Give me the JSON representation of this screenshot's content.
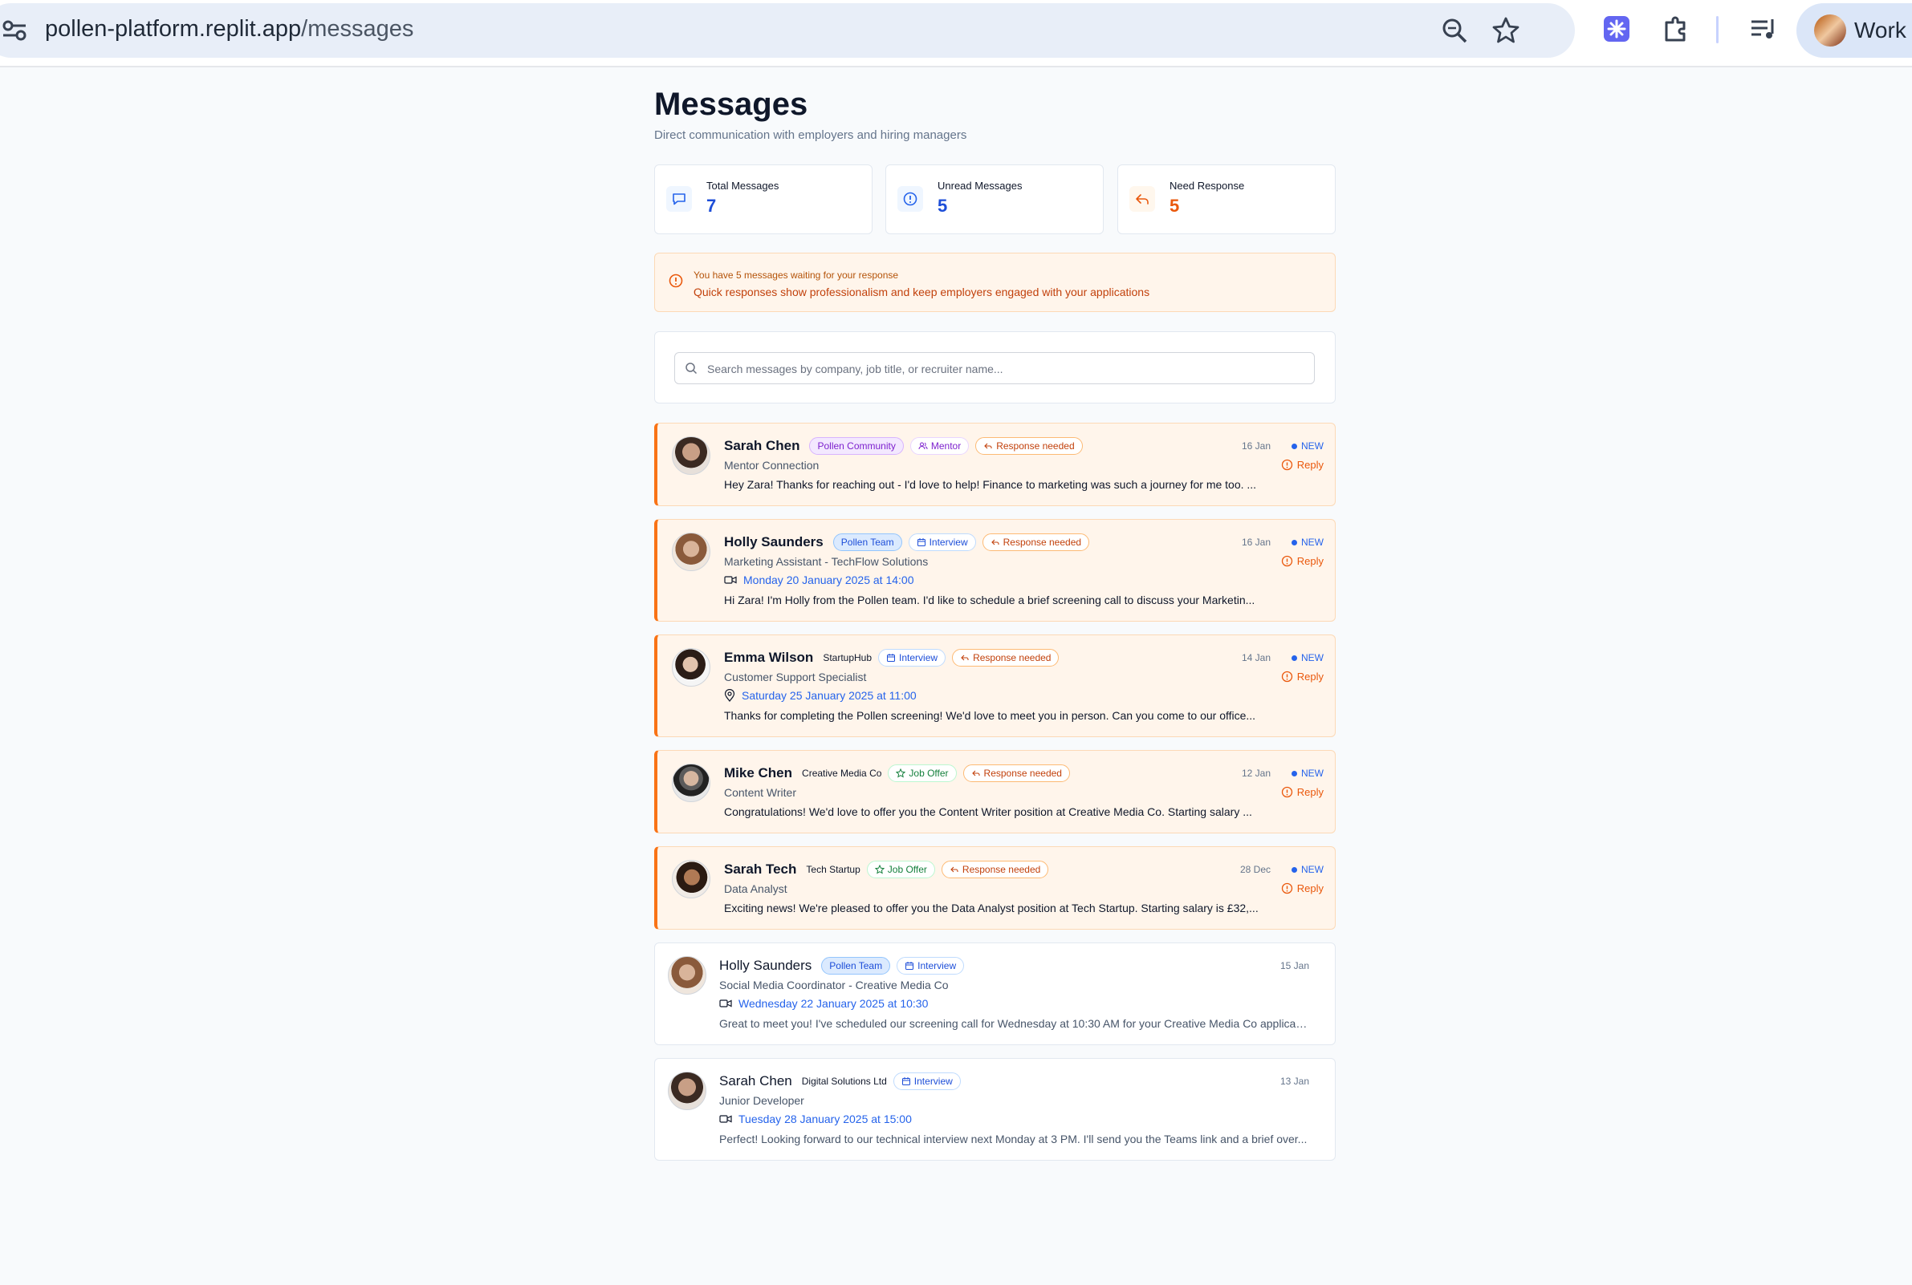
{
  "browser": {
    "url_host": "pollen-platform.replit.app",
    "url_path": "/messages",
    "profile_name": "Work"
  },
  "page": {
    "title": "Messages",
    "subtitle": "Direct communication with employers and hiring managers"
  },
  "stats": [
    {
      "label": "Total Messages",
      "value": "7",
      "color": "#1d4ed8",
      "icon": "chat-bubble-icon"
    },
    {
      "label": "Unread Messages",
      "value": "5",
      "color": "#1d4ed8",
      "icon": "alert-circle-icon"
    },
    {
      "label": "Need Response",
      "value": "5",
      "color": "#ea580c",
      "icon": "reply-icon"
    }
  ],
  "alert": {
    "title": "You have 5 messages waiting for your response",
    "body": "Quick responses show professionalism and keep employers engaged with your applications"
  },
  "search": {
    "placeholder": "Search messages by company, job title, or recruiter name..."
  },
  "labels": {
    "new": "NEW",
    "reply": "Reply"
  },
  "messages": [
    {
      "name": "Sarah Chen",
      "org": "Pollen Community",
      "tag": "Mentor",
      "response": "Response needed",
      "subtitle": "Mentor Connection",
      "preview": "Hey Zara! Thanks for reaching out - I'd love to help! Finance to marketing was such a journey for me too. ...",
      "date": "16 Jan"
    },
    {
      "name": "Holly Saunders",
      "org": "Pollen Team",
      "tag": "Interview",
      "response": "Response needed",
      "subtitle": "Marketing Assistant - TechFlow Solutions",
      "schedule": "Monday 20 January 2025 at 14:00",
      "preview": "Hi Zara! I'm Holly from the Pollen team. I'd like to schedule a brief screening call to discuss your Marketin...",
      "date": "16 Jan"
    },
    {
      "name": "Emma Wilson",
      "org": "StartupHub",
      "tag": "Interview",
      "response": "Response needed",
      "subtitle": "Customer Support Specialist",
      "schedule": "Saturday 25 January 2025 at 11:00",
      "preview": "Thanks for completing the Pollen screening! We'd love to meet you in person. Can you come to our office...",
      "date": "14 Jan"
    },
    {
      "name": "Mike Chen",
      "org": "Creative Media Co",
      "tag": "Job Offer",
      "response": "Response needed",
      "subtitle": "Content Writer",
      "preview": "Congratulations! We'd love to offer you the Content Writer position at Creative Media Co. Starting salary ...",
      "date": "12 Jan"
    },
    {
      "name": "Sarah Tech",
      "org": "Tech Startup",
      "tag": "Job Offer",
      "response": "Response needed",
      "subtitle": "Data Analyst",
      "preview": "Exciting news! We're pleased to offer you the Data Analyst position at Tech Startup. Starting salary is £32,...",
      "date": "28 Dec"
    },
    {
      "name": "Holly Saunders",
      "org": "Pollen Team",
      "tag": "Interview",
      "subtitle": "Social Media Coordinator - Creative Media Co",
      "schedule": "Wednesday 22 January 2025 at 10:30",
      "preview": "Great to meet you! I've scheduled our screening call for Wednesday at 10:30 AM for your Creative Media Co applicati...",
      "date": "15 Jan"
    },
    {
      "name": "Sarah Chen",
      "org": "Digital Solutions Ltd",
      "tag": "Interview",
      "subtitle": "Junior Developer",
      "schedule": "Tuesday 28 January 2025 at 15:00",
      "preview": "Perfect! Looking forward to our technical interview next Monday at 3 PM. I'll send you the Teams link and a brief over...",
      "date": "13 Jan"
    }
  ]
}
